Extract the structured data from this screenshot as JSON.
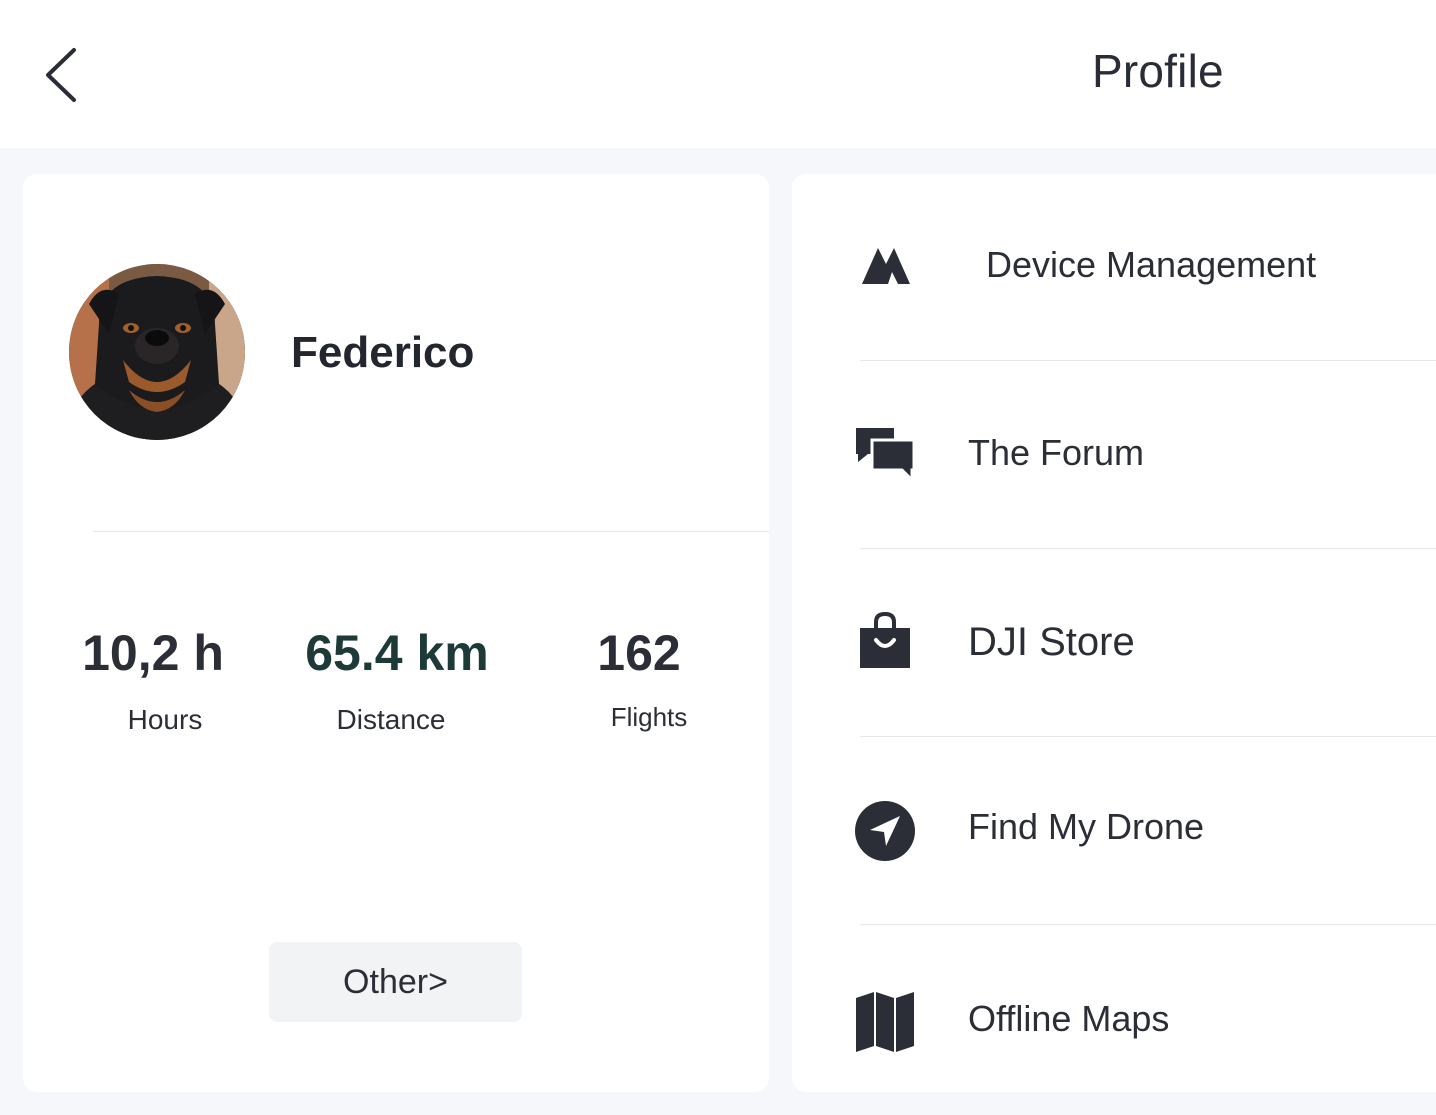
{
  "header": {
    "title": "Profile",
    "back_icon": "chevron-left-icon"
  },
  "profile": {
    "username": "Federico",
    "avatar": "avatar-rottweiler"
  },
  "stats": [
    {
      "value": "10,2 h",
      "label": "Hours"
    },
    {
      "value": "65.4 km",
      "label": "Distance"
    },
    {
      "value": "162",
      "label": "Flights"
    }
  ],
  "other_button": "Other>",
  "menu": [
    {
      "label": "Device Management",
      "icon": "drone-logo-icon"
    },
    {
      "label": "The Forum",
      "icon": "chat-bubbles-icon"
    },
    {
      "label": "DJI Store",
      "icon": "shopping-bag-icon"
    },
    {
      "label": "Find My Drone",
      "icon": "navigation-arrow-icon"
    },
    {
      "label": "Offline Maps",
      "icon": "map-icon"
    }
  ]
}
